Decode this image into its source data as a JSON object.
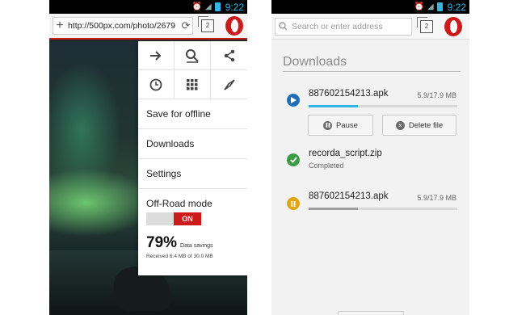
{
  "status_time": "9:22",
  "left": {
    "url": "http://500px.com/photo/2679",
    "menu": {
      "items": [
        "Save for offline",
        "Downloads",
        "Settings"
      ],
      "offroad": {
        "title": "Off-Road mode",
        "toggle": "ON",
        "savings_pct": "79%",
        "savings_label": "Data savings",
        "received": "Received 6.4 MB of 30.0 MB"
      }
    }
  },
  "right": {
    "search_placeholder": "Search or enter address",
    "heading": "Downloads",
    "downloads": [
      {
        "name": "887602154213.apk",
        "size": "5.9/17.9 MB",
        "progress": 0.33,
        "state": "downloading"
      },
      {
        "name": "recorda_script.zip",
        "status": "Completed",
        "state": "completed"
      },
      {
        "name": "887602154213.apk",
        "size": "5.9/17.9 MB",
        "progress": 0.33,
        "state": "paused"
      }
    ],
    "buttons": {
      "pause": "Pause",
      "delete": "Delete file"
    }
  },
  "colors": {
    "accent": "#cc1b1b",
    "progress": "#33b5e5",
    "completed": "#3a9c45",
    "paused": "#e0a813",
    "downloading": "#1f6fb8"
  }
}
